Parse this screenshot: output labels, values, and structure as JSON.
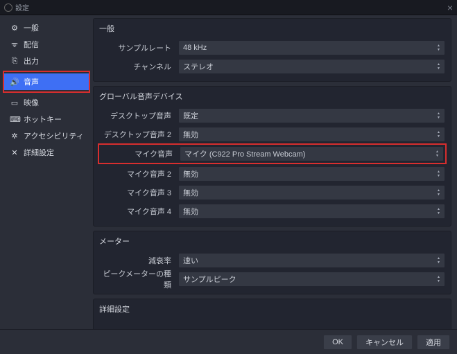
{
  "window": {
    "title": "設定"
  },
  "sidebar": {
    "items": [
      {
        "label": "一般"
      },
      {
        "label": "配信"
      },
      {
        "label": "出力"
      },
      {
        "label": "音声"
      },
      {
        "label": "映像"
      },
      {
        "label": "ホットキー"
      },
      {
        "label": "アクセシビリティ"
      },
      {
        "label": "詳細設定"
      }
    ]
  },
  "sections": {
    "general": {
      "title": "一般",
      "sample_rate": {
        "label": "サンプルレート",
        "value": "48 kHz"
      },
      "channel": {
        "label": "チャンネル",
        "value": "ステレオ"
      }
    },
    "global_devices": {
      "title": "グローバル音声デバイス",
      "desktop1": {
        "label": "デスクトップ音声",
        "value": "既定"
      },
      "desktop2": {
        "label": "デスクトップ音声 2",
        "value": "無効"
      },
      "mic1": {
        "label": "マイク音声",
        "value": "マイク (C922 Pro Stream Webcam)"
      },
      "mic2": {
        "label": "マイク音声 2",
        "value": "無効"
      },
      "mic3": {
        "label": "マイク音声 3",
        "value": "無効"
      },
      "mic4": {
        "label": "マイク音声 4",
        "value": "無効"
      }
    },
    "meters": {
      "title": "メーター",
      "decay": {
        "label": "減衰率",
        "value": "速い"
      },
      "peak": {
        "label": "ピークメーターの種類",
        "value": "サンプルピーク"
      }
    },
    "advanced": {
      "title": "詳細設定"
    }
  },
  "footer": {
    "ok": "OK",
    "cancel": "キャンセル",
    "apply": "適用"
  }
}
